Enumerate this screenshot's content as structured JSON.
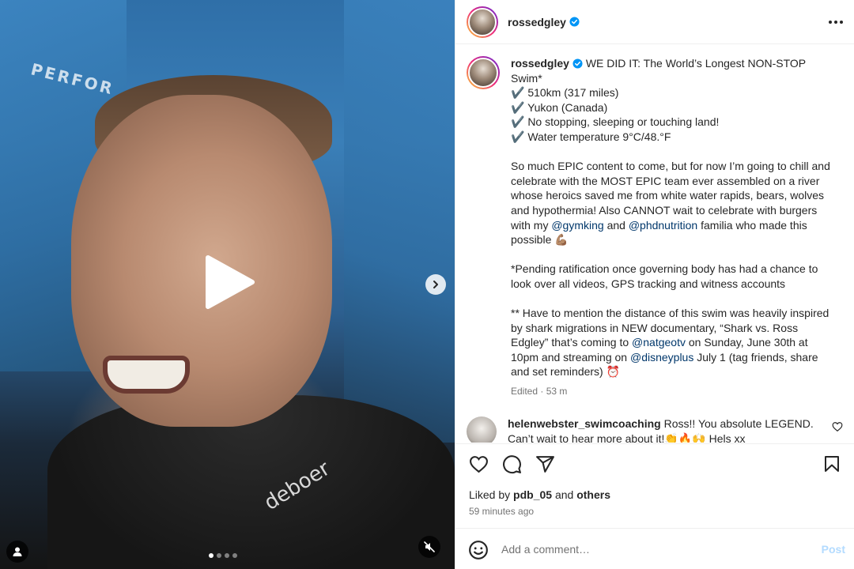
{
  "media": {
    "brand_top": "PERFOR",
    "brand_suit": "deboer",
    "carousel_dot_count": 4,
    "carousel_active_index": 0
  },
  "post": {
    "username": "rossedgley",
    "verified": true,
    "caption": {
      "lines_1": [
        "WE DID IT: The World’s Longest NON-STOP Swim*",
        "✔️ 510km (317 miles)",
        "✔️ Yukon (Canada)",
        "✔️ No stopping, sleeping or touching land!",
        "✔️ Water temperature 9°C/48.°F"
      ],
      "para2_a": "So much EPIC content to come, but for now I’m going to chill and celebrate with the MOST EPIC team ever assembled on a river whose heroics saved me from white water rapids, bears, wolves and hypothermia! Also CANNOT wait to celebrate with burgers with my ",
      "mention_1": "@gymking",
      "para2_b": " and ",
      "mention_2": "@phdnutrition",
      "para2_c": " familia who made this possible 💪🏽",
      "para3": "*Pending ratification once governing body has had a chance to look over all videos, GPS tracking and witness accounts",
      "para4_a": "** Have to mention the distance of this swim was heavily inspired by shark migrations in NEW documentary, “Shark vs. Ross Edgley” that’s coming to ",
      "mention_3": "@natgeotv",
      "para4_b": " on Sunday, June 30th at 10pm and streaming on ",
      "mention_4": "@disneyplus",
      "para4_c": " July 1 (tag friends, share and set reminders) ⏰"
    },
    "edited_label": "Edited",
    "separator": "·",
    "edited_time": "53 m"
  },
  "comment": {
    "username": "helenwebster_swimcoaching",
    "text": "Ross!! You absolute LEGEND. Can’t wait to hear more about it!👏🔥🙌 Hels xx"
  },
  "likes": {
    "prefix": "Liked by",
    "user": "pdb_05",
    "conj": "and",
    "others": "others"
  },
  "timestamp": "59 minutes ago",
  "add_comment": {
    "placeholder": "Add a comment…",
    "post_label": "Post"
  },
  "colors": {
    "text": "#262626",
    "secondary": "#737373",
    "mention": "#00376b",
    "verified": "#0095f6",
    "post_disabled": "#b3dbff",
    "divider": "#efefef"
  },
  "icons": [
    "play-icon",
    "chevron-right-icon",
    "user-tag-icon",
    "mute-icon",
    "verified-icon",
    "more-icon",
    "heart-icon",
    "comment-icon",
    "share-icon",
    "bookmark-icon",
    "emoji-icon"
  ]
}
